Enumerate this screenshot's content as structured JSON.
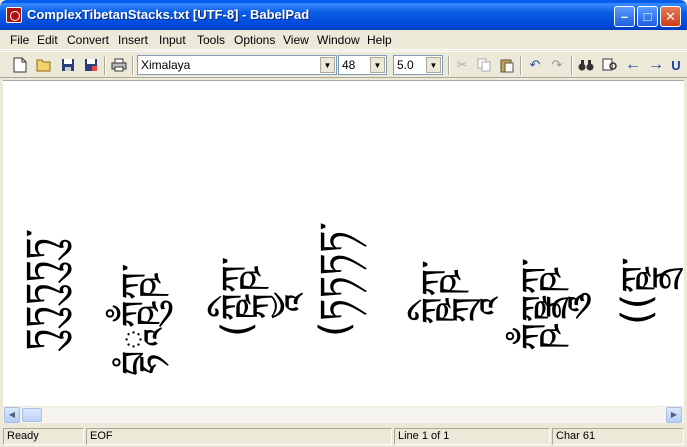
{
  "window": {
    "title": "ComplexTibetanStacks.txt [UTF-8] - BabelPad",
    "minimize": "–",
    "maximize": "□",
    "close": "✕"
  },
  "menu": {
    "items": [
      "File",
      "Edit",
      "Convert",
      "Insert",
      "Input",
      "Tools",
      "Options",
      "View",
      "Window",
      "Help"
    ]
  },
  "toolbar": {
    "font_name": "Ximalaya",
    "font_size": "48",
    "line_spacing": "5.0"
  },
  "document": {
    "lines": [
      "ཏུཏུཏུཏུཏུ་",
      "བྷཾཱཀྵུྃཀྵ་",
      "(ཀྵྐྱཱིཀྵ་",
      "(ཏཏཏཏ་",
      "ཀྵྐྲཱིཀྵ་",
      "ཀྵྃཀྵྣྲཱུཀྵ་",
      "((ཀྵྣྲ་"
    ]
  },
  "status": {
    "state": "Ready",
    "position": "EOF",
    "line": "Line 1 of 1",
    "char": "Char 61"
  }
}
